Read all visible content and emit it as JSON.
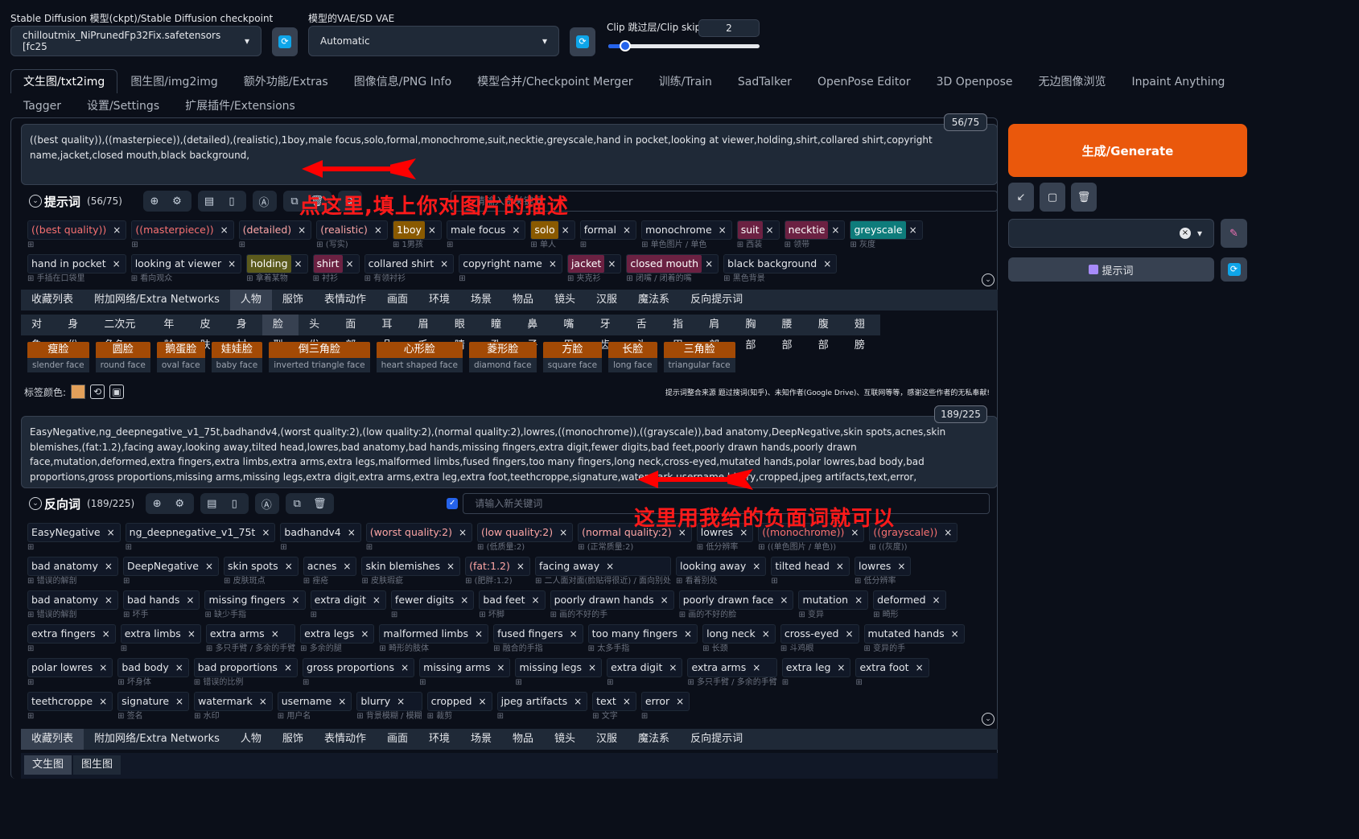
{
  "header": {
    "ckpt_label": "Stable Diffusion 模型(ckpt)/Stable Diffusion checkpoint",
    "ckpt_value": "chilloutmix_NiPrunedFp32Fix.safetensors [fc25",
    "vae_label": "模型的VAE/SD VAE",
    "vae_value": "Automatic",
    "clip_label": "Clip 跳过层/Clip skip",
    "clip_value": "2"
  },
  "tabs": [
    "文生图/txt2img",
    "图生图/img2img",
    "额外功能/Extras",
    "图像信息/PNG Info",
    "模型合并/Checkpoint Merger",
    "训练/Train",
    "SadTalker",
    "OpenPose Editor",
    "3D Openpose",
    "无边图像浏览",
    "Inpaint Anything",
    "Tagger",
    "设置/Settings",
    "扩展插件/Extensions"
  ],
  "prompt": {
    "counter": "56/75",
    "text": "((best quality)),((masterpiece)),(detailed),(realistic),1boy,male focus,solo,formal,monochrome,suit,necktie,greyscale,hand in pocket,looking at viewer,holding,shirt,collared shirt,copyright name,jacket,closed mouth,black background,",
    "title": "提示词",
    "count": "(56/75)",
    "placeholder": "请输入新关键词",
    "tags": [
      {
        "t": "((best quality))",
        "s": "",
        "c": "#111827",
        "tc": "#f87171"
      },
      {
        "t": "((masterpiece))",
        "s": "",
        "c": "#111827",
        "tc": "#f87171"
      },
      {
        "t": "(detailed)",
        "s": "",
        "c": "#111827",
        "tc": "#fca5a5"
      },
      {
        "t": "(realistic)",
        "s": "(写实)",
        "c": "#111827",
        "tc": "#fca5a5"
      },
      {
        "t": "1boy",
        "s": "1男孩",
        "c": "#8a5a00",
        "tc": "#fff"
      },
      {
        "t": "male focus",
        "s": "",
        "c": "#111827",
        "tc": "#e5e7eb"
      },
      {
        "t": "solo",
        "s": "单人",
        "c": "#8a5a00",
        "tc": "#fff"
      },
      {
        "t": "formal",
        "s": "",
        "c": "#111827",
        "tc": "#e5e7eb"
      },
      {
        "t": "monochrome",
        "s": "单色图片 / 单色",
        "c": "#111827",
        "tc": "#e5e7eb"
      },
      {
        "t": "suit",
        "s": "西装",
        "c": "#6b2142",
        "tc": "#fff"
      },
      {
        "t": "necktie",
        "s": "领带",
        "c": "#6b2142",
        "tc": "#fff"
      },
      {
        "t": "greyscale",
        "s": "灰度",
        "c": "#0e7c7b",
        "tc": "#fff"
      },
      {
        "t": "hand in pocket",
        "s": "手插在口袋里",
        "c": "#111827",
        "tc": "#e5e7eb"
      },
      {
        "t": "looking at viewer",
        "s": "看向观众",
        "c": "#111827",
        "tc": "#e5e7eb"
      },
      {
        "t": "holding",
        "s": "拿着某物",
        "c": "#5b5a1c",
        "tc": "#fff"
      },
      {
        "t": "shirt",
        "s": "衬衫",
        "c": "#6b2142",
        "tc": "#fff"
      },
      {
        "t": "collared shirt",
        "s": "有领衬衫",
        "c": "#111827",
        "tc": "#e5e7eb"
      },
      {
        "t": "copyright name",
        "s": "",
        "c": "#111827",
        "tc": "#e5e7eb"
      },
      {
        "t": "jacket",
        "s": "夹克衫",
        "c": "#6b2142",
        "tc": "#fff"
      },
      {
        "t": "closed mouth",
        "s": "闭嘴 / 闭着的嘴",
        "c": "#6b2142",
        "tc": "#fff"
      },
      {
        "t": "black background",
        "s": "黑色背景",
        "c": "#111827",
        "tc": "#e5e7eb"
      }
    ]
  },
  "categories": [
    "收藏列表",
    "附加网络/Extra Networks",
    "人物",
    "服饰",
    "表情动作",
    "画面",
    "环境",
    "场景",
    "物品",
    "镜头",
    "汉服",
    "魔法系",
    "反向提示词"
  ],
  "subcategories": [
    "对象",
    "身份",
    "二次元角色",
    "年龄",
    "皮肤",
    "身材",
    "脸型",
    "头发",
    "面部",
    "耳朵",
    "眉毛",
    "眼睛",
    "瞳孔",
    "鼻子",
    "嘴巴",
    "牙齿",
    "舌头",
    "指甲",
    "肩部",
    "胸部",
    "腰部",
    "腹部",
    "翅膀"
  ],
  "faces": [
    {
      "zh": "瘦脸",
      "en": "slender face"
    },
    {
      "zh": "圆脸",
      "en": "round face"
    },
    {
      "zh": "鹅蛋脸",
      "en": "oval face"
    },
    {
      "zh": "娃娃脸",
      "en": "baby face"
    },
    {
      "zh": "倒三角脸",
      "en": "inverted triangle face"
    },
    {
      "zh": "心形脸",
      "en": "heart shaped face"
    },
    {
      "zh": "菱形脸",
      "en": "diamond face"
    },
    {
      "zh": "方脸",
      "en": "square face"
    },
    {
      "zh": "长脸",
      "en": "long face"
    },
    {
      "zh": "三角脸",
      "en": "triangular face"
    }
  ],
  "tagcolor_label": "标签颜色:",
  "notice": "提示词整合来源 题过搜词(知乎)、未知作者(Google Drive)、互联网等等，感谢这些作者的无私奉献!",
  "negative": {
    "counter": "189/225",
    "text": "EasyNegative,ng_deepnegative_v1_75t,badhandv4,(worst quality:2),(low quality:2),(normal quality:2),lowres,((monochrome)),((grayscale)),bad anatomy,DeepNegative,skin spots,acnes,skin blemishes,(fat:1.2),facing away,looking away,tilted head,lowres,bad anatomy,bad hands,missing fingers,extra digit,fewer digits,bad feet,poorly drawn hands,poorly drawn face,mutation,deformed,extra fingers,extra limbs,extra arms,extra legs,malformed limbs,fused fingers,too many fingers,long neck,cross-eyed,mutated hands,polar lowres,bad body,bad proportions,gross proportions,missing arms,missing legs,extra digit,extra arms,extra leg,extra foot,teethcroppe,signature,watermark,username,blurry,cropped,jpeg artifacts,text,error,",
    "title": "反向词",
    "count": "(189/225)",
    "placeholder": "请输入新关键词",
    "tags": [
      {
        "t": "EasyNegative",
        "s": ""
      },
      {
        "t": "ng_deepnegative_v1_75t",
        "s": ""
      },
      {
        "t": "badhandv4",
        "s": ""
      },
      {
        "t": "(worst quality:2)",
        "s": "",
        "tc": "#fca5a5"
      },
      {
        "t": "(low quality:2)",
        "s": "(低质量:2)",
        "tc": "#fca5a5"
      },
      {
        "t": "(normal quality:2)",
        "s": "(正常质量:2)",
        "tc": "#fca5a5"
      },
      {
        "t": "lowres",
        "s": "低分辨率"
      },
      {
        "t": "((monochrome))",
        "s": "((单色图片 / 单色))",
        "tc": "#f87171"
      },
      {
        "t": "((grayscale))",
        "s": "((灰度))",
        "tc": "#f87171"
      },
      {
        "t": "bad anatomy",
        "s": "错误的解剖"
      },
      {
        "t": "DeepNegative",
        "s": ""
      },
      {
        "t": "skin spots",
        "s": "皮肤斑点"
      },
      {
        "t": "acnes",
        "s": "痤疮"
      },
      {
        "t": "skin blemishes",
        "s": "皮肤瑕疵"
      },
      {
        "t": "(fat:1.2)",
        "s": "(肥胖:1.2)",
        "tc": "#fca5a5"
      },
      {
        "t": "facing away",
        "s": "二人面对面(脸贴得很近) / 面向别处"
      },
      {
        "t": "looking away",
        "s": "看着别处"
      },
      {
        "t": "tilted head",
        "s": ""
      },
      {
        "t": "lowres",
        "s": "低分辨率"
      },
      {
        "t": "bad anatomy",
        "s": "错误的解剖"
      },
      {
        "t": "bad hands",
        "s": "坏手"
      },
      {
        "t": "missing fingers",
        "s": "缺少手指"
      },
      {
        "t": "extra digit",
        "s": ""
      },
      {
        "t": "fewer digits",
        "s": ""
      },
      {
        "t": "bad feet",
        "s": "坏脚"
      },
      {
        "t": "poorly drawn hands",
        "s": "画的不好的手"
      },
      {
        "t": "poorly drawn face",
        "s": "画的不好的脸"
      },
      {
        "t": "mutation",
        "s": "变异"
      },
      {
        "t": "deformed",
        "s": "畸形"
      },
      {
        "t": "extra fingers",
        "s": ""
      },
      {
        "t": "extra limbs",
        "s": ""
      },
      {
        "t": "extra arms",
        "s": "多只手臂 / 多余的手臂"
      },
      {
        "t": "extra legs",
        "s": "多余的腿"
      },
      {
        "t": "malformed limbs",
        "s": "畸形的肢体"
      },
      {
        "t": "fused fingers",
        "s": "融合的手指"
      },
      {
        "t": "too many fingers",
        "s": "太多手指"
      },
      {
        "t": "long neck",
        "s": "长颈"
      },
      {
        "t": "cross-eyed",
        "s": "斗鸡眼"
      },
      {
        "t": "mutated hands",
        "s": "变异的手"
      },
      {
        "t": "polar lowres",
        "s": ""
      },
      {
        "t": "bad body",
        "s": "坏身体"
      },
      {
        "t": "bad proportions",
        "s": "错误的比例"
      },
      {
        "t": "gross proportions",
        "s": ""
      },
      {
        "t": "missing arms",
        "s": ""
      },
      {
        "t": "missing legs",
        "s": ""
      },
      {
        "t": "extra digit",
        "s": ""
      },
      {
        "t": "extra arms",
        "s": "多只手臂 / 多余的手臂"
      },
      {
        "t": "extra leg",
        "s": ""
      },
      {
        "t": "extra foot",
        "s": ""
      },
      {
        "t": "teethcroppe",
        "s": ""
      },
      {
        "t": "signature",
        "s": "签名"
      },
      {
        "t": "watermark",
        "s": "水印"
      },
      {
        "t": "username",
        "s": "用户名"
      },
      {
        "t": "blurry",
        "s": "背景模糊 / 模糊"
      },
      {
        "t": "cropped",
        "s": "裁剪"
      },
      {
        "t": "jpeg artifacts",
        "s": ""
      },
      {
        "t": "text",
        "s": "文字"
      },
      {
        "t": "error",
        "s": ""
      }
    ]
  },
  "side": {
    "generate": "生成/Generate",
    "prompt_btn": "提示词"
  },
  "bottom_tabs": [
    "文生图",
    "图生图"
  ],
  "annotations": {
    "a1": "点这里,填上你对图片的描述",
    "a2": "这里用我给的负面词就可以"
  }
}
